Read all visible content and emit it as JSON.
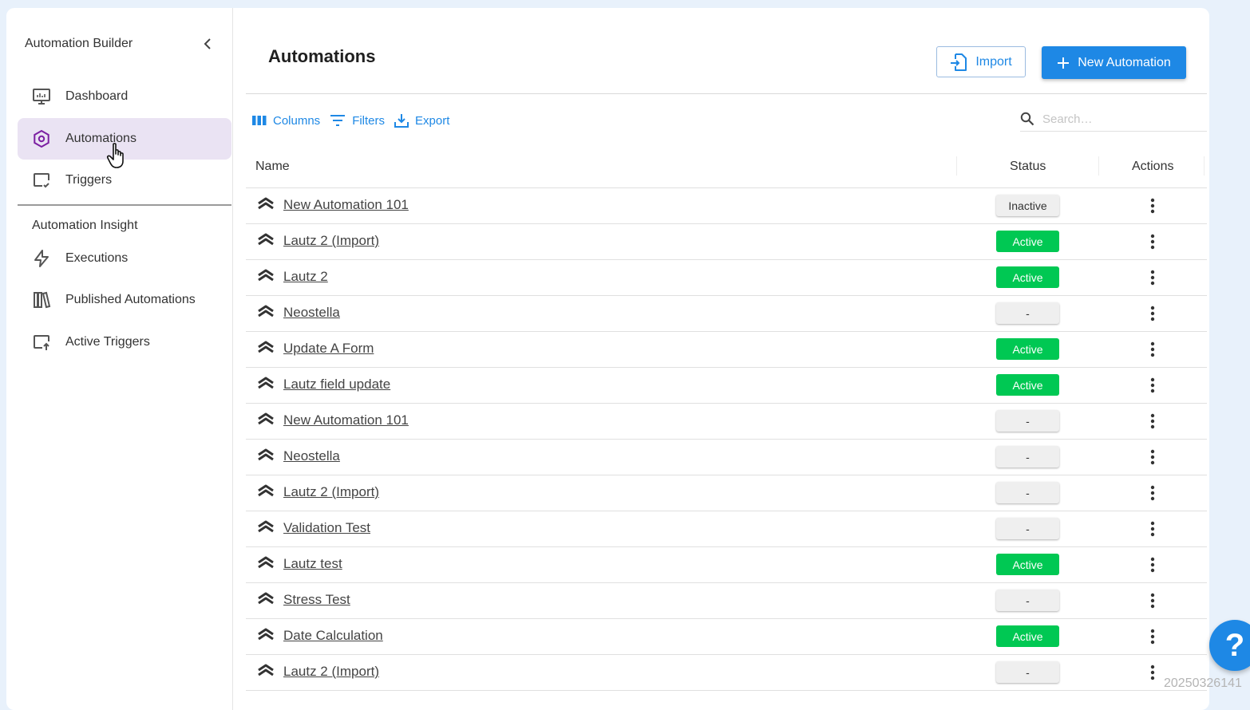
{
  "sidebar": {
    "title": "Automation Builder",
    "items": [
      {
        "label": "Dashboard",
        "icon": "dashboard-icon"
      },
      {
        "label": "Automations",
        "icon": "gear-icon",
        "active": true
      },
      {
        "label": "Triggers",
        "icon": "trigger-icon"
      }
    ],
    "section_label": "Automation Insight",
    "insight_items": [
      {
        "label": "Executions",
        "icon": "bolt-icon"
      },
      {
        "label": "Published Automations",
        "icon": "library-icon"
      },
      {
        "label": "Active Triggers",
        "icon": "active-trigger-icon"
      }
    ]
  },
  "header": {
    "title": "Automations",
    "import_label": "Import",
    "new_label": "New Automation"
  },
  "toolbar": {
    "columns_label": "Columns",
    "filters_label": "Filters",
    "export_label": "Export",
    "search_placeholder": "Search…"
  },
  "table": {
    "columns": [
      "Name",
      "Status",
      "Actions"
    ],
    "rows": [
      {
        "name": "New Automation 101",
        "status": "Inactive"
      },
      {
        "name": "Lautz 2 (Import)",
        "status": "Active"
      },
      {
        "name": "Lautz 2",
        "status": "Active"
      },
      {
        "name": "Neostella",
        "status": "-"
      },
      {
        "name": "Update A Form",
        "status": "Active"
      },
      {
        "name": "Lautz field update",
        "status": "Active"
      },
      {
        "name": "New Automation 101",
        "status": "-"
      },
      {
        "name": "Neostella",
        "status": "-"
      },
      {
        "name": "Lautz 2 (Import)",
        "status": "-"
      },
      {
        "name": "Validation Test",
        "status": "-"
      },
      {
        "name": "Lautz test",
        "status": "Active"
      },
      {
        "name": "Stress Test",
        "status": "-"
      },
      {
        "name": "Date Calculation",
        "status": "Active"
      },
      {
        "name": "Lautz 2 (Import)",
        "status": "-"
      }
    ]
  },
  "help": {
    "label": "?"
  },
  "watermark": "20250326141",
  "colors": {
    "accent": "#1e88e5",
    "active": "#00c853",
    "selected_nav": "#eae3f3"
  }
}
